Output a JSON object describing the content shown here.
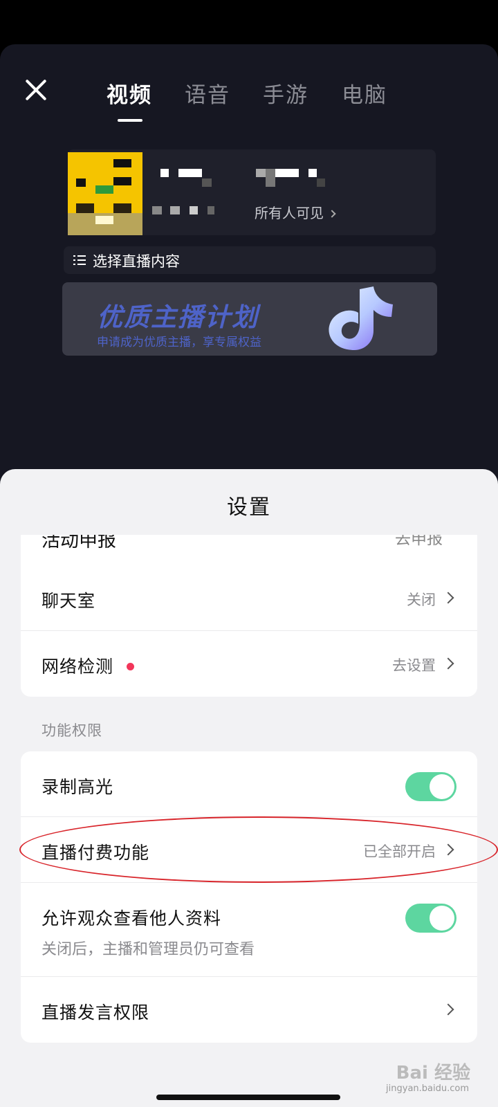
{
  "tabs": [
    {
      "label": "视频",
      "active": true
    },
    {
      "label": "语音",
      "active": false
    },
    {
      "label": "手游",
      "active": false
    },
    {
      "label": "电脑",
      "active": false
    }
  ],
  "profile": {
    "visibility_label": "所有人可见"
  },
  "select_content": {
    "label": "选择直播内容",
    "icon": "list-icon"
  },
  "banner": {
    "title": "优质主播计划",
    "subtitle": "申请成为优质主播，享专属权益"
  },
  "settings": {
    "title": "设置",
    "cut_row": {
      "label": "活动申报",
      "value": "去申报"
    },
    "group1": [
      {
        "label": "聊天室",
        "value": "关闭"
      },
      {
        "label": "网络检测",
        "value": "去设置",
        "badge": "red-dot"
      }
    ],
    "section_header": "功能权限",
    "group2": [
      {
        "label": "录制高光",
        "toggle": true
      },
      {
        "label": "直播付费功能",
        "value": "已全部开启"
      },
      {
        "label": "允许观众查看他人资料",
        "sub": "关闭后，主播和管理员仍可查看",
        "toggle": true
      },
      {
        "label": "直播发言权限"
      }
    ]
  },
  "watermark": {
    "brand": "Bai 经验",
    "url": "jingyan.baidu.com"
  },
  "colors": {
    "toggle_on": "#5dd6a0",
    "badge": "#f2365a",
    "annotation": "#d8242a"
  }
}
